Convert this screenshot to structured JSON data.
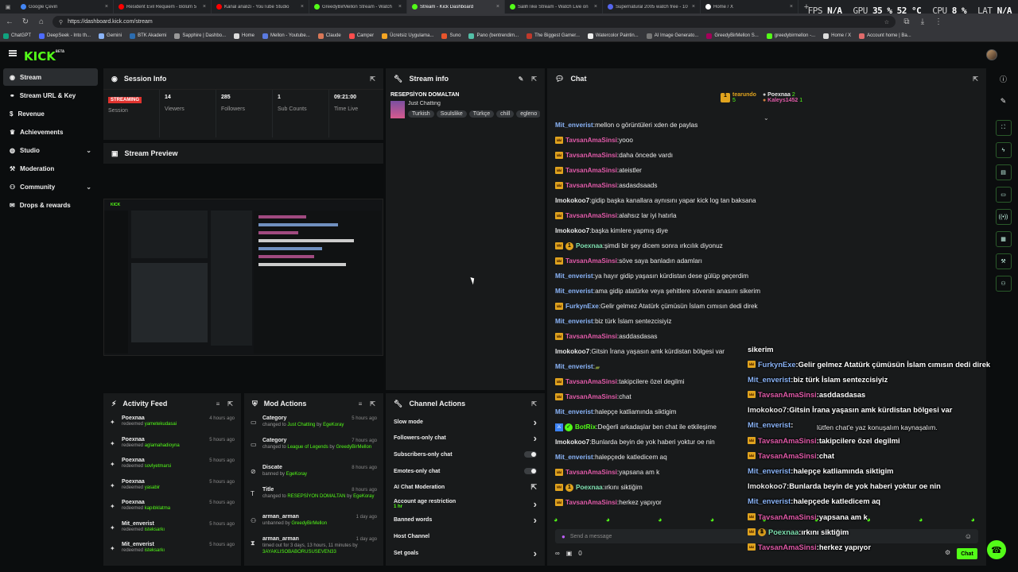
{
  "browser": {
    "tabs": [
      {
        "label": "Google Çeviri",
        "color": "#4285f4"
      },
      {
        "label": "Resident Evil Requiem - Bölüm 5",
        "color": "#ff0000"
      },
      {
        "label": "Kanal analizi - YouTube Studio",
        "color": "#ff0000"
      },
      {
        "label": "GreedyBirMellon Stream - Watch",
        "color": "#53fc18"
      },
      {
        "label": "Stream - Kick Dashboard",
        "color": "#53fc18",
        "active": true
      },
      {
        "label": "SalihTike Stream - Watch Live on",
        "color": "#53fc18"
      },
      {
        "label": "Supernatural 2005 watch free - 10",
        "color": "#5566ee"
      },
      {
        "label": "Home / X",
        "color": "#ffffff"
      }
    ],
    "url": "https://dashboard.kick.com/stream",
    "bookmarks": [
      "ChatGPT",
      "DeepSeek - Into th...",
      "Gemini",
      "BTK Akademi",
      "Sapphire | Dashbo...",
      "Home",
      "Mellon - Youtube...",
      "Claude",
      "Camper",
      "Ücretsiz Uygulama...",
      "Suno",
      "Pano (bentrendim...",
      "The Biggest Gamer...",
      "Watercolor Paintin...",
      "AI Image Generato...",
      "GreedyBirMellon S...",
      "greedybirmellon -...",
      "Home / X",
      "Account home | Ba..."
    ]
  },
  "hud": {
    "fps_label": "FPS",
    "fps_value": "N/A",
    "gpu_label": "GPU",
    "gpu_value": "35 % 52 °C",
    "cpu_label": "CPU",
    "cpu_value": "8 %",
    "lat_label": "LAT",
    "lat_value": "N/A"
  },
  "logo": "KICK",
  "logo_sup": "BETA",
  "sidebar": {
    "items": [
      {
        "label": "Stream",
        "icon": "radio-icon",
        "active": true
      },
      {
        "label": "Stream URL & Key",
        "icon": "link-icon"
      },
      {
        "label": "Revenue",
        "icon": "dollar-icon"
      },
      {
        "label": "Achievements",
        "icon": "trophy-icon"
      },
      {
        "label": "Studio",
        "icon": "globe-icon",
        "chevron": true
      },
      {
        "label": "Moderation",
        "icon": "wrench-icon"
      },
      {
        "label": "Community",
        "icon": "users-icon",
        "chevron": true
      },
      {
        "label": "Drops & rewards",
        "icon": "gift-icon"
      }
    ]
  },
  "session": {
    "title": "Session Info",
    "status_badge": "STREAMING",
    "status_label": "Session",
    "stats": [
      {
        "value": "14",
        "label": "Viewers"
      },
      {
        "value": "285",
        "label": "Followers"
      },
      {
        "value": "1",
        "label": "Sub Counts"
      },
      {
        "value": "09:21:00",
        "label": "Time Live"
      }
    ]
  },
  "stream_info": {
    "title": "Stream info",
    "stream_title": "RESEPSİYON DOMALTAN",
    "category": "Just Chatting",
    "tags": [
      "Turkish",
      "Soulslike",
      "Türkçe",
      "chill",
      "egleno"
    ]
  },
  "preview": {
    "title": "Stream Preview"
  },
  "activity": {
    "title": "Activity Feed",
    "items": [
      {
        "name": "Poexnaa",
        "action": "redeemed",
        "target": "yametekudasai",
        "time": "4 hours ago"
      },
      {
        "name": "Poexnaa",
        "action": "redeemed",
        "target": "aglamahadioyna",
        "time": "5 hours ago"
      },
      {
        "name": "Poexnaa",
        "action": "redeemed",
        "target": "sovlyetmarsi",
        "time": "5 hours ago"
      },
      {
        "name": "Poexnaa",
        "action": "redeemed",
        "target": "yasabir",
        "time": "5 hours ago"
      },
      {
        "name": "Poexnaa",
        "action": "redeemed",
        "target": "kapıbklatma",
        "time": "5 hours ago"
      },
      {
        "name": "Mit_enverist",
        "action": "redeemed",
        "target": "isteksarkı",
        "time": "5 hours ago"
      },
      {
        "name": "Mit_enverist",
        "action": "redeemed",
        "target": "isteksarkı",
        "time": "5 hours ago"
      }
    ]
  },
  "mod_actions": {
    "title": "Mod Actions",
    "items": [
      {
        "title": "Category",
        "line1": "changed to",
        "hl1": "Just Chatting",
        "line2": " by ",
        "hl2": "EgeKoray",
        "time": "5 hours ago"
      },
      {
        "title": "Category",
        "line1": "changed to",
        "hl1": "League of Legends",
        "line2": " by ",
        "hl2": "GreedyBirMellon",
        "time": "7 hours ago"
      },
      {
        "title": "Discate",
        "line1": "banned by",
        "hl1": "EgeKoray",
        "line2": "",
        "hl2": "",
        "time": "8 hours ago"
      },
      {
        "title": "Title",
        "line1": "changed to",
        "hl1": "RESEPSİYON DOMALTAN",
        "line2": " by ",
        "hl2": "EgeKoray",
        "time": "8 hours ago"
      },
      {
        "title": "arman_arman",
        "line1": "unbanned by",
        "hl1": "GreedyBirMellon",
        "line2": "",
        "hl2": "",
        "time": "1 day ago"
      },
      {
        "title": "arman_arman",
        "line1": "timed out for 3 days, 13 hours, 11 minutes by",
        "hl1": "3AYAKLISOBABORUSUSEVEN33",
        "line2": "",
        "hl2": "",
        "time": "1 day ago"
      }
    ]
  },
  "channel_actions": {
    "title": "Channel Actions",
    "rows": [
      {
        "label": "Slow mode",
        "control": "chevron"
      },
      {
        "label": "Followers-only chat",
        "control": "chevron"
      },
      {
        "label": "Subscribers-only chat",
        "control": "toggle"
      },
      {
        "label": "Emotes-only chat",
        "control": "toggle"
      },
      {
        "label": "AI Chat Moderation",
        "control": "external"
      },
      {
        "label": "Account age restriction",
        "sub": "1 hr",
        "control": "chevron"
      },
      {
        "label": "Banned words",
        "control": "chevron"
      },
      {
        "label": "Host Channel",
        "control": "none"
      },
      {
        "label": "Set goals",
        "control": "chevron"
      }
    ]
  },
  "chat": {
    "title": "Chat",
    "top_gifters": [
      {
        "name": "tearundo",
        "count": "5"
      },
      {
        "name": "Poexnaa",
        "count": "2"
      },
      {
        "name": "Kaleys1452",
        "count": "1"
      }
    ],
    "messages": [
      {
        "user": "Mit_enverist",
        "color": "#8ab4f8",
        "badge": "",
        "text": "mellon o görüntüleri xden de paylas"
      },
      {
        "user": "TavsanAmaSinsi",
        "color": "#e05aa8",
        "badge": "crown",
        "text": "yooo"
      },
      {
        "user": "TavsanAmaSinsi",
        "color": "#e05aa8",
        "badge": "crown",
        "text": "daha öncede vardı"
      },
      {
        "user": "TavsanAmaSinsi",
        "color": "#e05aa8",
        "badge": "crown",
        "text": "ateistler"
      },
      {
        "user": "TavsanAmaSinsi",
        "color": "#e05aa8",
        "badge": "crown",
        "text": "asdasdsaads"
      },
      {
        "user": "Imokokoo7",
        "color": "#e8e8e8",
        "badge": "",
        "text": "gidip başka kanallara aynısını yapar kick log tan baksana"
      },
      {
        "user": "TavsanAmaSinsi",
        "color": "#e05aa8",
        "badge": "crown",
        "text": "alahsız lar iyi hatırla"
      },
      {
        "user": "Imokokoo7",
        "color": "#e8e8e8",
        "badge": "",
        "text": "başka kimlere yapmış diye"
      },
      {
        "user": "Poexnaa",
        "color": "#7ee0b0",
        "badge": "crown1",
        "text": "şimdi bir şey dicem sonra ırkcılık diyonuz"
      },
      {
        "user": "TavsanAmaSinsi",
        "color": "#e05aa8",
        "badge": "crown",
        "text": "söve saya banladın adamları"
      },
      {
        "user": "Mit_enverist",
        "color": "#8ab4f8",
        "badge": "",
        "text": "ya hayır gidip yaşasın kürdistan dese gülüp geçerdim"
      },
      {
        "user": "Mit_enverist",
        "color": "#8ab4f8",
        "badge": "",
        "text": "ama gidip atatürke veya şehitlere sövenin anasını sikerim"
      },
      {
        "user": "FurkynExe",
        "color": "#8ab4f8",
        "badge": "crown",
        "text": "Gelir gelmez Atatürk çümüsün İslam cımısın dedi direk"
      },
      {
        "user": "Mit_enverist",
        "color": "#8ab4f8",
        "badge": "",
        "text": "biz türk İslam sentezcisiyiz"
      },
      {
        "user": "TavsanAmaSinsi",
        "color": "#e05aa8",
        "badge": "crown",
        "text": "asddasdasas"
      },
      {
        "user": "Imokokoo7",
        "color": "#e8e8e8",
        "badge": "",
        "text": "Gitsin İrana yaşasın amk kürdistan bölgesi var"
      },
      {
        "user": "Mit_enverist",
        "color": "#8ab4f8",
        "badge": "",
        "text": ""
      },
      {
        "user": "TavsanAmaSinsi",
        "color": "#e05aa8",
        "badge": "crown",
        "text": "takipcilere özel degilmi"
      },
      {
        "user": "TavsanAmaSinsi",
        "color": "#e05aa8",
        "badge": "crown",
        "text": "chat"
      },
      {
        "user": "Mit_enverist",
        "color": "#8ab4f8",
        "badge": "",
        "text": "halepçe katliamında siktigim"
      },
      {
        "user": "BotRix",
        "color": "#53fc18",
        "badge": "bot",
        "text": "Değerli arkadaşlar ben chat ile etkileşime"
      },
      {
        "user": "Imokokoo7",
        "color": "#e8e8e8",
        "badge": "",
        "text": "Bunlarda beyin de yok haberi yoktur oe nin"
      },
      {
        "user": "Mit_enverist",
        "color": "#8ab4f8",
        "badge": "",
        "text": "halepçede katledicem aq"
      },
      {
        "user": "TavsanAmaSinsi",
        "color": "#e05aa8",
        "badge": "crown",
        "text": "yapsana am k"
      },
      {
        "user": "Poexnaa",
        "color": "#7ee0b0",
        "badge": "crown1",
        "text": "ırkını siktiğim"
      },
      {
        "user": "TavsanAmaSinsi",
        "color": "#e05aa8",
        "badge": "crown",
        "text": "herkez yapıyor"
      }
    ],
    "input_placeholder": "Send a message",
    "count_value": "0",
    "send_label": "Chat"
  },
  "overlay": {
    "first_word": "sikerim",
    "botrix_tail": "lütfen chat'e yaz konuşalım kaynaşalım.",
    "lines": [
      {
        "user": "FurkynExe",
        "color": "#8ab4f8",
        "badge": "crown",
        "text": "Gelir gelmez Atatürk çümüsün İslam cımısın dedi direk"
      },
      {
        "user": "Mit_enverist",
        "color": "#8ab4f8",
        "badge": "",
        "text": "biz türk İslam sentezcisiyiz"
      },
      {
        "user": "TavsanAmaSinsi",
        "color": "#e05aa8",
        "badge": "crown",
        "text": "asddasdasas"
      },
      {
        "user": "Imokokoo7",
        "color": "#e8e8e8",
        "badge": "",
        "text": "Gitsin İrana yaşasın amk kürdistan bölgesi var"
      },
      {
        "user": "Mit_enverist",
        "color": "#8ab4f8",
        "badge": "",
        "text": ""
      },
      {
        "user": "TavsanAmaSinsi",
        "color": "#e05aa8",
        "badge": "crown",
        "text": "takipcilere özel degilmi"
      },
      {
        "user": "TavsanAmaSinsi",
        "color": "#e05aa8",
        "badge": "crown",
        "text": "chat"
      },
      {
        "user": "Mit_enverist",
        "color": "#8ab4f8",
        "badge": "",
        "text": "halepçe katliamında siktigim"
      },
      {
        "user": "Imokokoo7",
        "color": "#e8e8e8",
        "badge": "",
        "text": "Bunlarda beyin de yok haberi yoktur oe nin"
      },
      {
        "user": "Mit_enverist",
        "color": "#8ab4f8",
        "badge": "",
        "text": "halepçede katledicem aq"
      },
      {
        "user": "TavsanAmaSinsi",
        "color": "#e05aa8",
        "badge": "crown",
        "text": "yapsana am k"
      },
      {
        "user": "Poexnaa",
        "color": "#7ee0b0",
        "badge": "crown1",
        "text": "ırkını siktiğim"
      },
      {
        "user": "TavsanAmaSinsi",
        "color": "#e05aa8",
        "badge": "crown",
        "text": "herkez yapıyor"
      }
    ]
  },
  "right_rail": [
    "info-icon",
    "pencil-icon",
    "fullscreen-icon",
    "bolt-icon",
    "clipboard-icon",
    "chat-icon",
    "broadcast-icon",
    "storefront-icon",
    "wrench-icon",
    "users-icon"
  ],
  "colors": {
    "accent": "#53fc18",
    "panel": "#181a1b",
    "bg": "#0b0d0e",
    "live": "#e0332f"
  }
}
